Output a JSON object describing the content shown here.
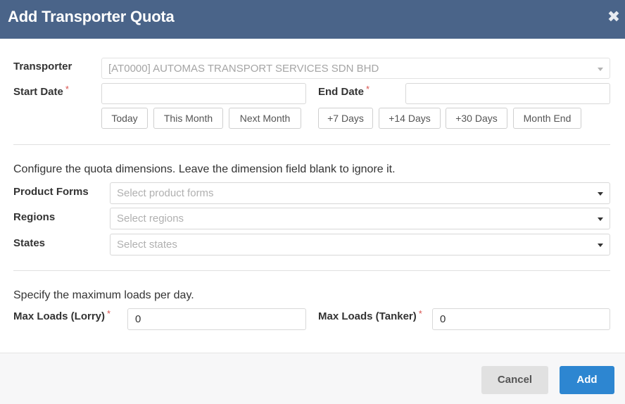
{
  "dialog": {
    "title": "Add Transporter Quota",
    "close_icon": "close-icon"
  },
  "form": {
    "transporter": {
      "label": "Transporter",
      "value": "[AT0000] AUTOMAS TRANSPORT SERVICES SDN BHD"
    },
    "start_date": {
      "label": "Start Date",
      "required": "*",
      "value": ""
    },
    "end_date": {
      "label": "End Date",
      "required": "*",
      "value": ""
    },
    "start_shortcuts": [
      "Today",
      "This Month",
      "Next Month"
    ],
    "end_shortcuts": [
      "+7 Days",
      "+14 Days",
      "+30 Days",
      "Month End"
    ]
  },
  "dimensions": {
    "note": "Configure the quota dimensions. Leave the dimension field blank to ignore it.",
    "product_forms": {
      "label": "Product Forms",
      "placeholder": "Select product forms"
    },
    "regions": {
      "label": "Regions",
      "placeholder": "Select regions"
    },
    "states": {
      "label": "States",
      "placeholder": "Select states"
    }
  },
  "loads": {
    "note": "Specify the maximum loads per day.",
    "lorry": {
      "label": "Max Loads (Lorry)",
      "required": "*",
      "value": "0"
    },
    "tanker": {
      "label": "Max Loads (Tanker)",
      "required": "*",
      "value": "0"
    }
  },
  "footer": {
    "cancel_label": "Cancel",
    "add_label": "Add"
  },
  "colors": {
    "header": "#4a6489",
    "primary": "#2d86d1",
    "required": "#d9534f"
  }
}
